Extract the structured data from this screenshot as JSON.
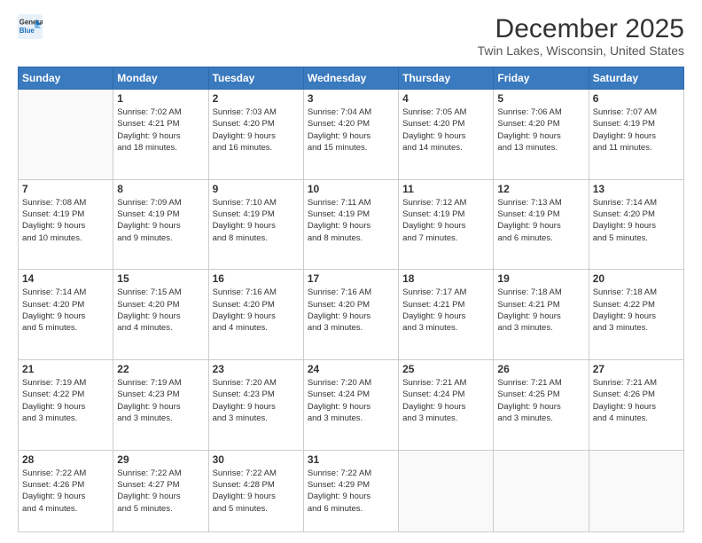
{
  "header": {
    "logo_line1": "General",
    "logo_line2": "Blue",
    "main_title": "December 2025",
    "subtitle": "Twin Lakes, Wisconsin, United States"
  },
  "days_of_week": [
    "Sunday",
    "Monday",
    "Tuesday",
    "Wednesday",
    "Thursday",
    "Friday",
    "Saturday"
  ],
  "weeks": [
    [
      {
        "day": "",
        "info": ""
      },
      {
        "day": "1",
        "info": "Sunrise: 7:02 AM\nSunset: 4:21 PM\nDaylight: 9 hours\nand 18 minutes."
      },
      {
        "day": "2",
        "info": "Sunrise: 7:03 AM\nSunset: 4:20 PM\nDaylight: 9 hours\nand 16 minutes."
      },
      {
        "day": "3",
        "info": "Sunrise: 7:04 AM\nSunset: 4:20 PM\nDaylight: 9 hours\nand 15 minutes."
      },
      {
        "day": "4",
        "info": "Sunrise: 7:05 AM\nSunset: 4:20 PM\nDaylight: 9 hours\nand 14 minutes."
      },
      {
        "day": "5",
        "info": "Sunrise: 7:06 AM\nSunset: 4:20 PM\nDaylight: 9 hours\nand 13 minutes."
      },
      {
        "day": "6",
        "info": "Sunrise: 7:07 AM\nSunset: 4:19 PM\nDaylight: 9 hours\nand 11 minutes."
      }
    ],
    [
      {
        "day": "7",
        "info": "Sunrise: 7:08 AM\nSunset: 4:19 PM\nDaylight: 9 hours\nand 10 minutes."
      },
      {
        "day": "8",
        "info": "Sunrise: 7:09 AM\nSunset: 4:19 PM\nDaylight: 9 hours\nand 9 minutes."
      },
      {
        "day": "9",
        "info": "Sunrise: 7:10 AM\nSunset: 4:19 PM\nDaylight: 9 hours\nand 8 minutes."
      },
      {
        "day": "10",
        "info": "Sunrise: 7:11 AM\nSunset: 4:19 PM\nDaylight: 9 hours\nand 8 minutes."
      },
      {
        "day": "11",
        "info": "Sunrise: 7:12 AM\nSunset: 4:19 PM\nDaylight: 9 hours\nand 7 minutes."
      },
      {
        "day": "12",
        "info": "Sunrise: 7:13 AM\nSunset: 4:19 PM\nDaylight: 9 hours\nand 6 minutes."
      },
      {
        "day": "13",
        "info": "Sunrise: 7:14 AM\nSunset: 4:20 PM\nDaylight: 9 hours\nand 5 minutes."
      }
    ],
    [
      {
        "day": "14",
        "info": "Sunrise: 7:14 AM\nSunset: 4:20 PM\nDaylight: 9 hours\nand 5 minutes."
      },
      {
        "day": "15",
        "info": "Sunrise: 7:15 AM\nSunset: 4:20 PM\nDaylight: 9 hours\nand 4 minutes."
      },
      {
        "day": "16",
        "info": "Sunrise: 7:16 AM\nSunset: 4:20 PM\nDaylight: 9 hours\nand 4 minutes."
      },
      {
        "day": "17",
        "info": "Sunrise: 7:16 AM\nSunset: 4:20 PM\nDaylight: 9 hours\nand 3 minutes."
      },
      {
        "day": "18",
        "info": "Sunrise: 7:17 AM\nSunset: 4:21 PM\nDaylight: 9 hours\nand 3 minutes."
      },
      {
        "day": "19",
        "info": "Sunrise: 7:18 AM\nSunset: 4:21 PM\nDaylight: 9 hours\nand 3 minutes."
      },
      {
        "day": "20",
        "info": "Sunrise: 7:18 AM\nSunset: 4:22 PM\nDaylight: 9 hours\nand 3 minutes."
      }
    ],
    [
      {
        "day": "21",
        "info": "Sunrise: 7:19 AM\nSunset: 4:22 PM\nDaylight: 9 hours\nand 3 minutes."
      },
      {
        "day": "22",
        "info": "Sunrise: 7:19 AM\nSunset: 4:23 PM\nDaylight: 9 hours\nand 3 minutes."
      },
      {
        "day": "23",
        "info": "Sunrise: 7:20 AM\nSunset: 4:23 PM\nDaylight: 9 hours\nand 3 minutes."
      },
      {
        "day": "24",
        "info": "Sunrise: 7:20 AM\nSunset: 4:24 PM\nDaylight: 9 hours\nand 3 minutes."
      },
      {
        "day": "25",
        "info": "Sunrise: 7:21 AM\nSunset: 4:24 PM\nDaylight: 9 hours\nand 3 minutes."
      },
      {
        "day": "26",
        "info": "Sunrise: 7:21 AM\nSunset: 4:25 PM\nDaylight: 9 hours\nand 3 minutes."
      },
      {
        "day": "27",
        "info": "Sunrise: 7:21 AM\nSunset: 4:26 PM\nDaylight: 9 hours\nand 4 minutes."
      }
    ],
    [
      {
        "day": "28",
        "info": "Sunrise: 7:22 AM\nSunset: 4:26 PM\nDaylight: 9 hours\nand 4 minutes."
      },
      {
        "day": "29",
        "info": "Sunrise: 7:22 AM\nSunset: 4:27 PM\nDaylight: 9 hours\nand 5 minutes."
      },
      {
        "day": "30",
        "info": "Sunrise: 7:22 AM\nSunset: 4:28 PM\nDaylight: 9 hours\nand 5 minutes."
      },
      {
        "day": "31",
        "info": "Sunrise: 7:22 AM\nSunset: 4:29 PM\nDaylight: 9 hours\nand 6 minutes."
      },
      {
        "day": "",
        "info": ""
      },
      {
        "day": "",
        "info": ""
      },
      {
        "day": "",
        "info": ""
      }
    ]
  ]
}
